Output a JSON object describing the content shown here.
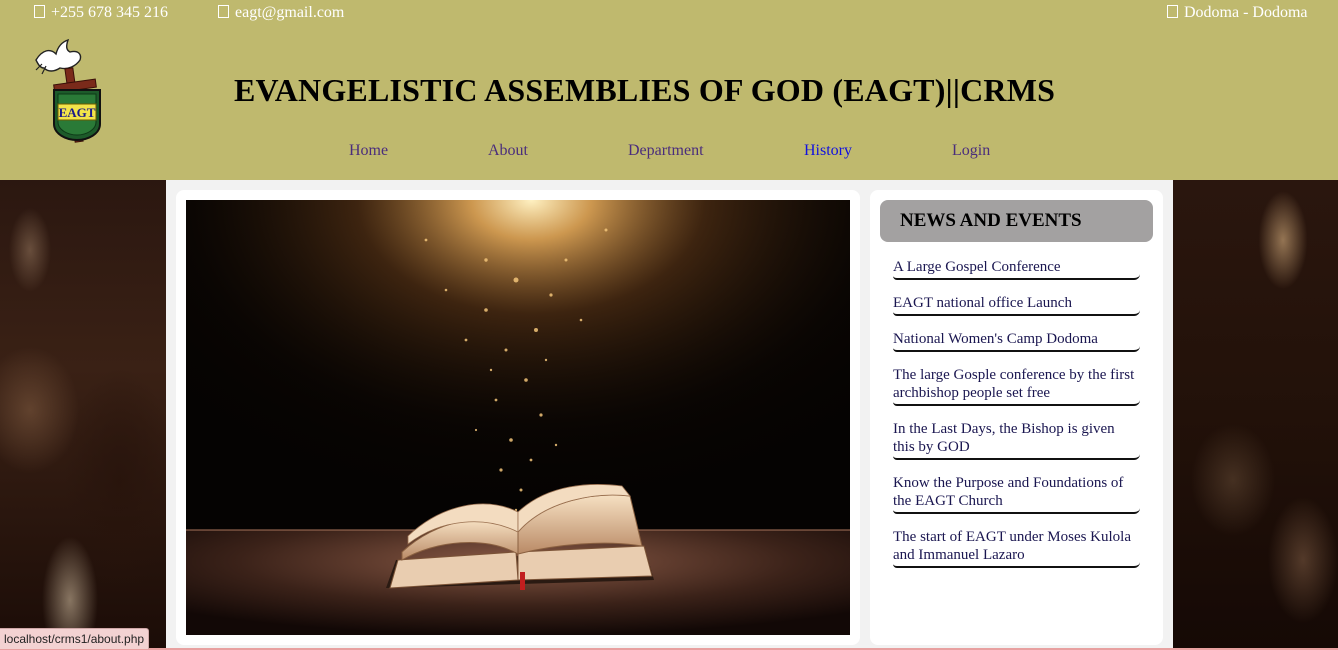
{
  "topbar": {
    "phone": "+255 678 345 216",
    "email": "eagt@gmail.com",
    "location": "Dodoma - Dodoma",
    "phone_icon": "phone-icon",
    "email_icon": "envelope-icon",
    "location_icon": "map-marker-icon"
  },
  "logo": {
    "text": "EAGT"
  },
  "site": {
    "title": "EVANGELISTIC ASSEMBLIES OF GOD (EAGT)||CRMS"
  },
  "nav": {
    "home": "Home",
    "about": "About",
    "department": "Department",
    "history": "History",
    "login": "Login"
  },
  "news": {
    "heading": "NEWS AND EVENTS",
    "items": [
      "A Large Gospel Conference",
      "EAGT national office Launch",
      "National Women's Camp Dodoma",
      "The large Gosple conference by the first archbishop people set free",
      "In the Last Days, the Bishop is given this by GOD",
      "Know the Purpose and Foundations of the EAGT Church",
      "The start of EAGT under Moses Kulola and Immanuel Lazaro"
    ]
  },
  "status_bar": {
    "url": "localhost/crms1/about.php"
  },
  "colors": {
    "header_bg": "#bfb96e",
    "nav_link": "#4a2d7c",
    "nav_active": "#1010e0",
    "news_heading_bg": "#a3a1a1",
    "news_item_text": "#1a1650"
  }
}
